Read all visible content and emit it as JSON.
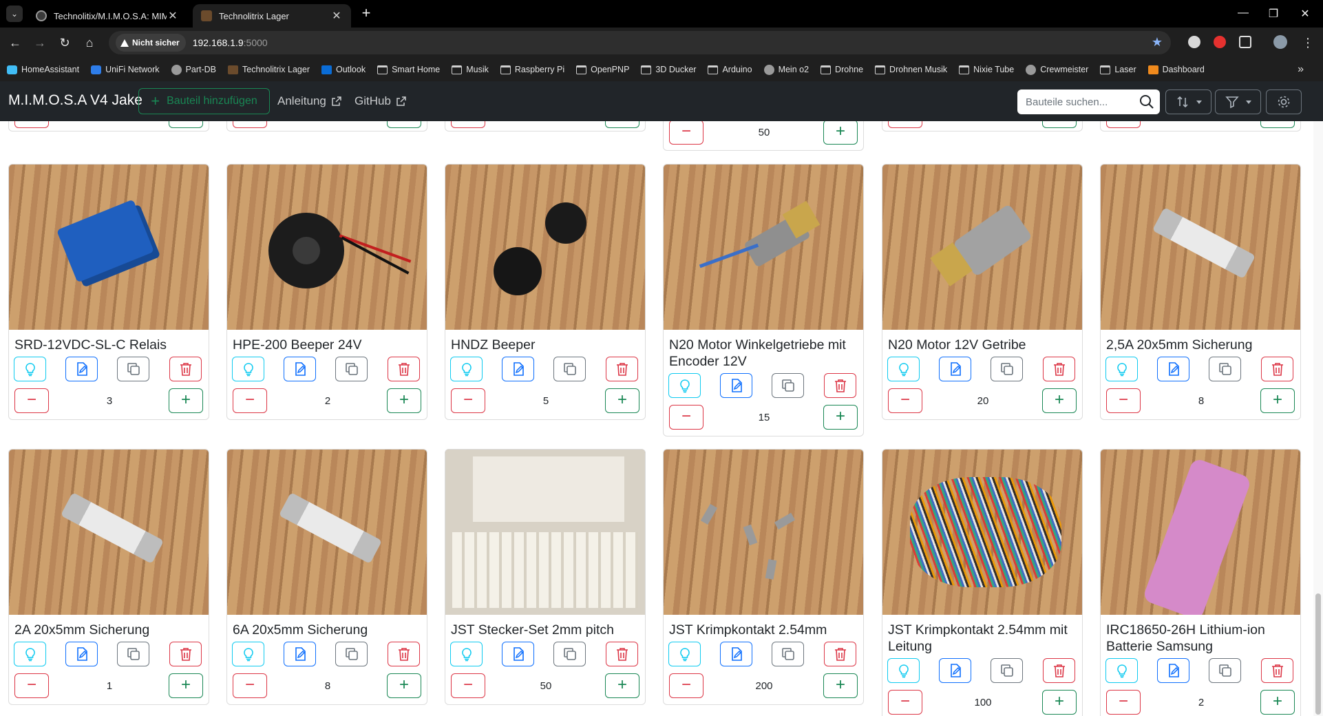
{
  "browser": {
    "tabs": [
      {
        "title": "Technolitix/M.I.M.O.S.A: MIMOS"
      },
      {
        "title": "Technolitrix Lager"
      }
    ],
    "security_label": "Nicht sicher",
    "url_host": "192.168.1.9",
    "url_port": ":5000",
    "bookmarks": [
      {
        "label": "HomeAssistant",
        "icon": "ha"
      },
      {
        "label": "UniFi Network",
        "icon": "blue"
      },
      {
        "label": "Part-DB",
        "icon": "round"
      },
      {
        "label": "Technolitrix Lager",
        "icon": "brown"
      },
      {
        "label": "Outlook",
        "icon": "outlook"
      },
      {
        "label": "Smart Home",
        "icon": "folder"
      },
      {
        "label": "Musik",
        "icon": "folder"
      },
      {
        "label": "Raspberry Pi",
        "icon": "folder"
      },
      {
        "label": "OpenPNP",
        "icon": "folder"
      },
      {
        "label": "3D Ducker",
        "icon": "folder"
      },
      {
        "label": "Arduino",
        "icon": "folder"
      },
      {
        "label": "Mein o2",
        "icon": "round"
      },
      {
        "label": "Drohne",
        "icon": "folder"
      },
      {
        "label": "Drohnen Musik",
        "icon": "folder"
      },
      {
        "label": "Nixie Tube",
        "icon": "folder"
      },
      {
        "label": "Crewmeister",
        "icon": "round"
      },
      {
        "label": "Laser",
        "icon": "folder"
      },
      {
        "label": "Dashboard",
        "icon": "orange"
      }
    ]
  },
  "app": {
    "brand": "M.I.M.O.S.A V4 Jake",
    "add_part_label": "Bauteil hinzufügen",
    "nav_links": [
      "Anleitung",
      "GitHub"
    ],
    "search_placeholder": "Bauteile suchen...",
    "accent_colors": {
      "success": "#198754",
      "danger": "#dc3545",
      "info": "#0dcaf0",
      "primary": "#0d6efd",
      "secondary": "#6c757d"
    }
  },
  "partial_row": [
    {
      "quantity": ""
    },
    {
      "quantity": ""
    },
    {
      "quantity": ""
    },
    {
      "quantity": "50"
    },
    {
      "quantity": ""
    },
    {
      "quantity": ""
    }
  ],
  "parts": [
    {
      "title": "SRD-12VDC-SL-C Relais",
      "quantity": "3",
      "image": "relay"
    },
    {
      "title": "HPE-200 Beeper 24V",
      "quantity": "2",
      "image": "beeper-wired"
    },
    {
      "title": "HNDZ Beeper",
      "quantity": "5",
      "image": "beepers"
    },
    {
      "title": "N20 Motor Winkelgetriebe mit Encoder 12V",
      "quantity": "15",
      "image": "motor-encoder"
    },
    {
      "title": "N20 Motor 12V Getribe",
      "quantity": "20",
      "image": "motor"
    },
    {
      "title": "2,5A 20x5mm Sicherung",
      "quantity": "8",
      "image": "fuse"
    },
    {
      "title": "2A 20x5mm Sicherung",
      "quantity": "1",
      "image": "fuse"
    },
    {
      "title": "6A 20x5mm Sicherung",
      "quantity": "8",
      "image": "fuse"
    },
    {
      "title": "JST Stecker-Set 2mm pitch",
      "quantity": "50",
      "image": "jst-set"
    },
    {
      "title": "JST Krimpkontakt 2.54mm",
      "quantity": "200",
      "image": "crimp"
    },
    {
      "title": "JST Krimpkontakt 2.54mm mit Leitung",
      "quantity": "100",
      "image": "wires"
    },
    {
      "title": "IRC18650-26H Lithium-ion Batterie Samsung",
      "quantity": "2",
      "image": "battery"
    }
  ]
}
